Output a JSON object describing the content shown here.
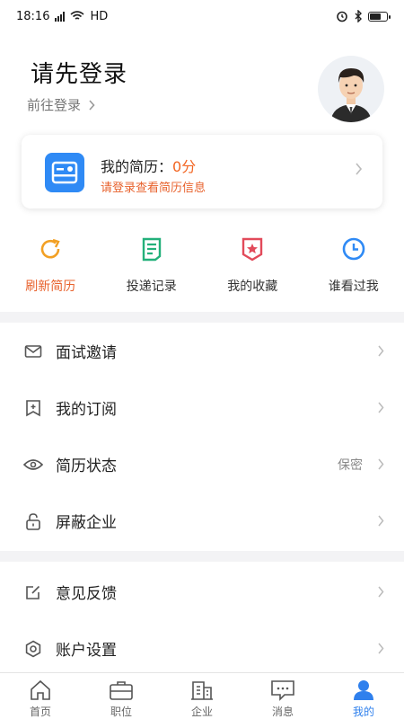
{
  "status_bar": {
    "time": "18:16",
    "network": "HD"
  },
  "header": {
    "title": "请先登录",
    "login_link": "前往登录"
  },
  "resume_card": {
    "title": "我的简历：",
    "score": "0分",
    "hint": "请登录查看简历信息"
  },
  "quick_actions": [
    {
      "label": "刷新简历",
      "icon": "refresh-icon"
    },
    {
      "label": "投递记录",
      "icon": "delivery-record-icon"
    },
    {
      "label": "我的收藏",
      "icon": "favorites-icon"
    },
    {
      "label": "谁看过我",
      "icon": "clock-icon"
    }
  ],
  "menu": [
    {
      "label": "面试邀请",
      "icon": "mail-icon",
      "value": ""
    },
    {
      "label": "我的订阅",
      "icon": "subscribe-icon",
      "value": ""
    },
    {
      "label": "简历状态",
      "icon": "eye-icon",
      "value": "保密"
    },
    {
      "label": "屏蔽企业",
      "icon": "lock-icon",
      "value": ""
    },
    {
      "label": "意见反馈",
      "icon": "edit-icon",
      "value": ""
    },
    {
      "label": "账户设置",
      "icon": "gear-icon",
      "value": ""
    }
  ],
  "bottom_nav": [
    {
      "label": "首页",
      "icon": "home-icon",
      "active": false
    },
    {
      "label": "职位",
      "icon": "briefcase-icon",
      "active": false
    },
    {
      "label": "企业",
      "icon": "building-icon",
      "active": false
    },
    {
      "label": "消息",
      "icon": "message-icon",
      "active": false
    },
    {
      "label": "我的",
      "icon": "user-icon",
      "active": true
    }
  ],
  "colors": {
    "accent_blue": "#2f80ed",
    "accent_orange": "#e8622d",
    "divider": "#f3f3f5"
  }
}
